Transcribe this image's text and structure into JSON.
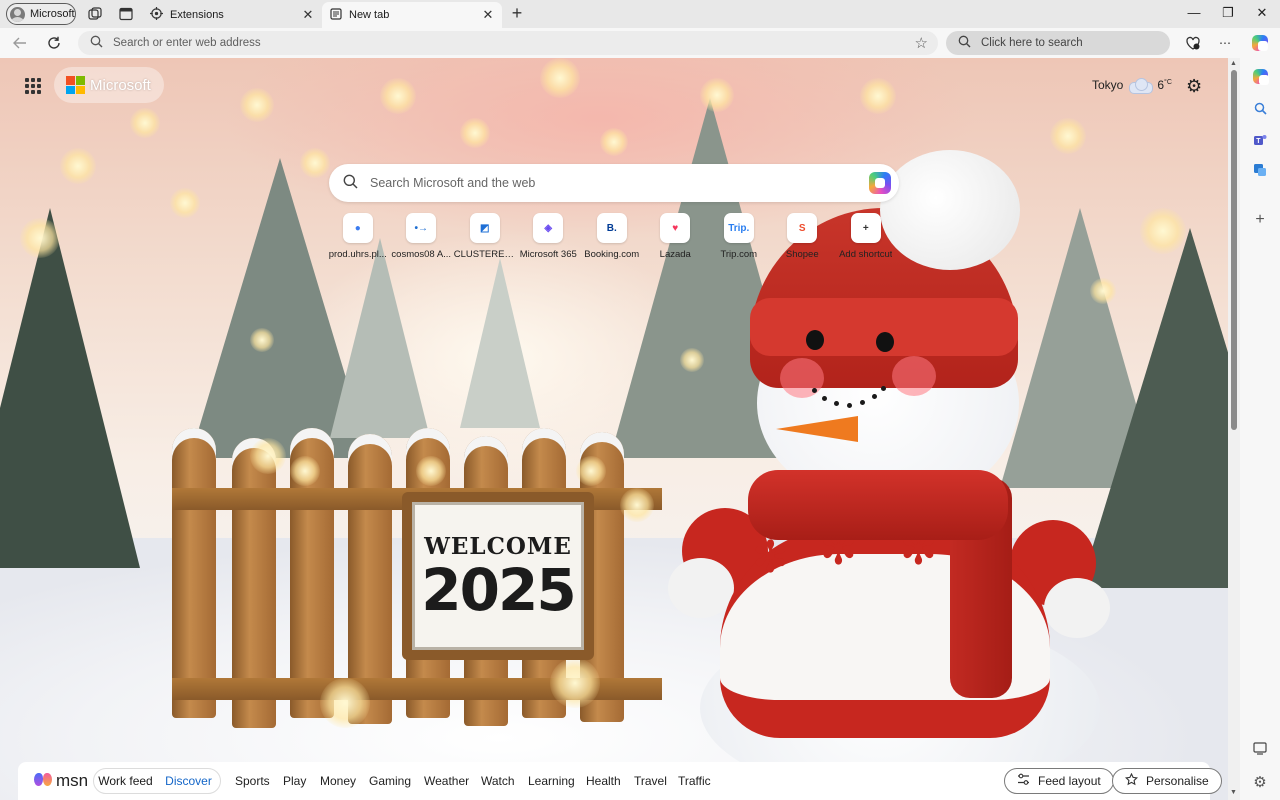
{
  "tabbar": {
    "profile_label": "Microsoft",
    "tabs": [
      {
        "label": "Extensions",
        "icon": "extensions-icon",
        "active": false
      },
      {
        "label": "New tab",
        "icon": "newtab-page-icon",
        "active": true
      }
    ],
    "close_glyph": "✕",
    "newtab_glyph": "+",
    "window": {
      "minimize": "—",
      "restore": "❐",
      "close": "✕"
    }
  },
  "navbar": {
    "address_placeholder": "Search or enter web address",
    "search_placeholder": "Click here to search"
  },
  "page": {
    "brand_label": "Microsoft",
    "weather": {
      "city": "Tokyo",
      "temp": "6",
      "unit": "°C"
    },
    "search_placeholder": "Search Microsoft and the web",
    "shortcuts": [
      {
        "label": "prod.uhrs.pl...",
        "tile": "●",
        "color": "#3b7cf0"
      },
      {
        "label": "cosmos08 A...",
        "tile": "•→",
        "color": "#1f6fd1"
      },
      {
        "label": "CLUSTERED ...",
        "tile": "◩",
        "color": "#1e6fd6"
      },
      {
        "label": "Microsoft 365",
        "tile": "◈",
        "color": "#6a4cf0"
      },
      {
        "label": "Booking.com",
        "tile": "B.",
        "color": "#003b95"
      },
      {
        "label": "Lazada",
        "tile": "♥",
        "color": "#f5365c"
      },
      {
        "label": "Trip.com",
        "tile": "Trip.",
        "color": "#2a7ef0"
      },
      {
        "label": "Shopee",
        "tile": "S",
        "color": "#ee4d2d"
      },
      {
        "label": "Add shortcut",
        "tile": "+",
        "color": "#333333"
      }
    ],
    "sign": {
      "line1": "WELCOME",
      "line2": "2025"
    }
  },
  "msn": {
    "logo": "msn",
    "toggle": {
      "work": "Work feed",
      "discover": "Discover"
    },
    "links": [
      "Sports",
      "Play",
      "Money",
      "Gaming",
      "Weather",
      "Watch",
      "Learning",
      "Health",
      "Travel",
      "Traffic"
    ],
    "feed_layout": "Feed layout",
    "personalise": "Personalise"
  },
  "colors": {
    "accent_blue": "#1466c8",
    "scarf_red": "#c7271f"
  }
}
